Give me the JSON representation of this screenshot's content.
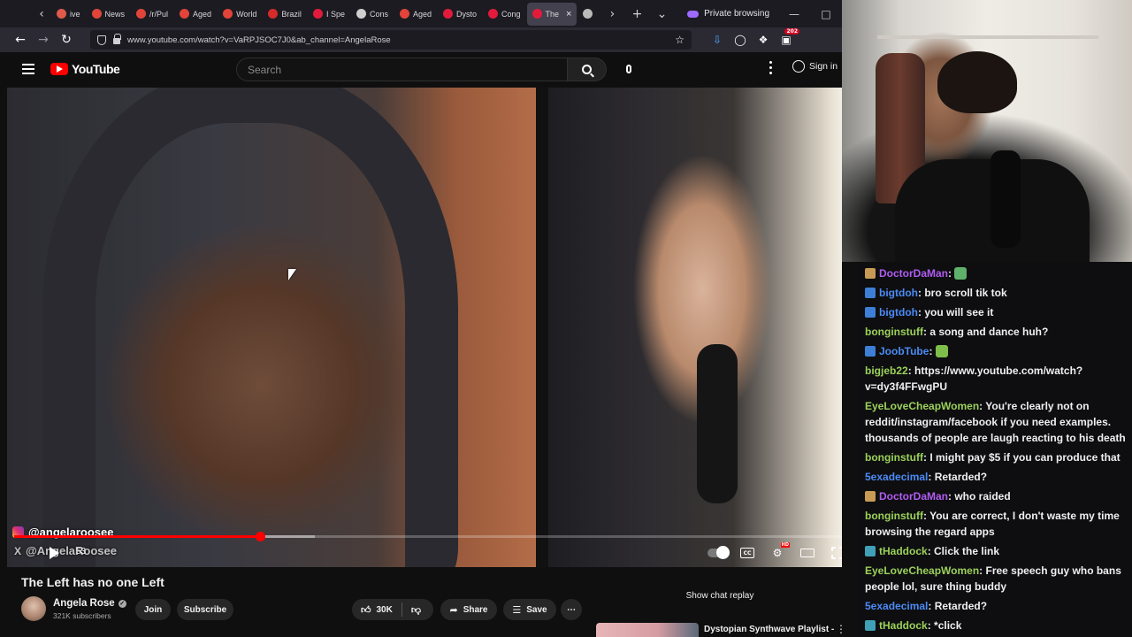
{
  "browser": {
    "tabs": [
      {
        "label": "ive",
        "fav": "#e05a4b",
        "active": false
      },
      {
        "label": "News",
        "fav": "#e2443a",
        "active": false
      },
      {
        "label": "/r/Pul",
        "fav": "#e2443a",
        "active": false
      },
      {
        "label": "Aged",
        "fav": "#e2443a",
        "active": false
      },
      {
        "label": "World",
        "fav": "#e2443a",
        "active": false
      },
      {
        "label": "Brazil",
        "fav": "#d42b2b",
        "active": false
      },
      {
        "label": "I Spe",
        "fav": "#e21b3c",
        "active": false
      },
      {
        "label": "Cons",
        "fav": "#cfcfcf",
        "active": false
      },
      {
        "label": "Aged",
        "fav": "#e2443a",
        "active": false
      },
      {
        "label": "Dysto",
        "fav": "#e21b3c",
        "active": false
      },
      {
        "label": "Cong",
        "fav": "#e21b3c",
        "active": false
      },
      {
        "label": "The",
        "fav": "#e21b3c",
        "active": true
      },
      {
        "label": "",
        "fav": "#bbbbbb",
        "active": false
      }
    ],
    "private_label": "Private browsing",
    "url": "www.youtube.com/watch?v=VaRPJSOC7J0&ab_channel=AngelaRose",
    "extension_badge": "202"
  },
  "youtube": {
    "logo_text": "YouTube",
    "search_placeholder": "Search",
    "signin_label": "Sign in",
    "video": {
      "ig_handle": "@angelaroosee",
      "x_handle": "@AngelaRoosee",
      "time_fragment": "53",
      "progress_played": 0.295,
      "progress_buffered": 0.36,
      "title": "The Left has no one Left"
    },
    "channel": {
      "name": "Angela Rose",
      "subscribers": "321K subscribers",
      "join_label": "Join",
      "subscribe_label": "Subscribe"
    },
    "actions": {
      "likes": "30K",
      "share_label": "Share",
      "save_label": "Save"
    },
    "show_chat_replay": "Show chat replay",
    "playlist_title": "Dystopian Synthwave Playlist -"
  },
  "chat": {
    "messages": [
      {
        "user": "DoctorDaMan",
        "color": "#b05cf2",
        "badge": "#c99a55",
        "text": ":",
        "emote": "#5fb06b"
      },
      {
        "user": "bigtdoh",
        "color": "#4b8bf5",
        "badge": "#3d7fd6",
        "text": ": bro scroll tik tok"
      },
      {
        "user": "bigtdoh",
        "color": "#4b8bf5",
        "badge": "#3d7fd6",
        "text": ": you will see it"
      },
      {
        "user": "bonginstuff",
        "color": "#9bd15a",
        "badge": "",
        "text": ": a song and dance huh?"
      },
      {
        "user": "JoobTube",
        "color": "#4b8bf5",
        "badge": "#3d7fd6",
        "text": ":",
        "emote": "#7dbf4a"
      },
      {
        "user": "bigjeb22",
        "color": "#9bd15a",
        "badge": "",
        "text": ": https://www.youtube.com/watch?v=dy3f4FFwgPU"
      },
      {
        "user": "EyeLoveCheapWomen",
        "color": "#9bd15a",
        "badge": "",
        "text": ": You're clearly not on reddit/instagram/facebook if you need examples. thousands of people are laugh reacting to his death"
      },
      {
        "user": "bonginstuff",
        "color": "#9bd15a",
        "badge": "",
        "text": ": I might pay $5 if you can produce that"
      },
      {
        "user": "5exadecimal",
        "color": "#4b8bf5",
        "badge": "",
        "text": ": Retarded?"
      },
      {
        "user": "DoctorDaMan",
        "color": "#b05cf2",
        "badge": "#c99a55",
        "text": ": who raided"
      },
      {
        "user": "bonginstuff",
        "color": "#9bd15a",
        "badge": "",
        "text": ": You are correct, I don't waste my time browsing the regard apps"
      },
      {
        "user": "tHaddock",
        "color": "#9bd15a",
        "badge": "#3fa0b8",
        "text": ": Click the link"
      },
      {
        "user": "EyeLoveCheapWomen",
        "color": "#9bd15a",
        "badge": "",
        "text": ": Free speech guy who bans people lol, sure thing buddy"
      },
      {
        "user": "5exadecimal",
        "color": "#4b8bf5",
        "badge": "",
        "text": ": Retarded?"
      },
      {
        "user": "tHaddock",
        "color": "#9bd15a",
        "badge": "#3fa0b8",
        "text": ": *click"
      }
    ]
  }
}
